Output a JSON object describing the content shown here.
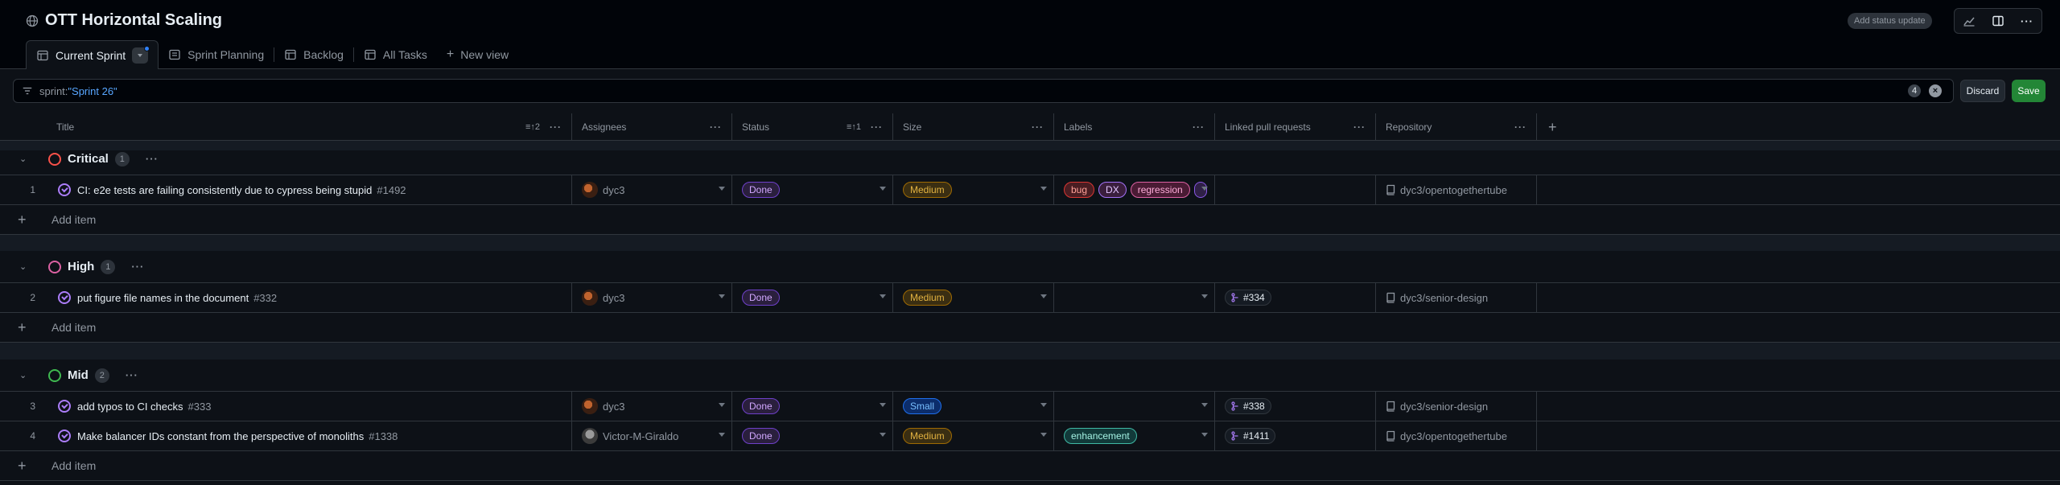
{
  "project": {
    "title": "OTT Horizontal Scaling",
    "status_update": "Add status update"
  },
  "tabs": [
    {
      "label": "Current Sprint"
    },
    {
      "label": "Sprint Planning"
    },
    {
      "label": "Backlog"
    },
    {
      "label": "All Tasks"
    },
    {
      "label": "New view"
    }
  ],
  "filter": {
    "key": "sprint:",
    "value": "\"Sprint 26\"",
    "count": "4",
    "discard": "Discard",
    "save": "Save"
  },
  "columns": {
    "title": "Title",
    "title_sort": "2",
    "assignees": "Assignees",
    "status": "Status",
    "status_sort": "1",
    "size": "Size",
    "labels": "Labels",
    "linked_prs": "Linked pull requests",
    "repository": "Repository"
  },
  "add_item_label": "Add item",
  "groups": [
    {
      "name": "Critical",
      "count": "1",
      "color": "#f85149",
      "rows": [
        {
          "num": "1",
          "title": "CI: e2e tests are failing consistently due to cypress being stupid",
          "issue": "#1492",
          "assignee": "dyc3",
          "status": "Done",
          "size": "Medium",
          "labels": [
            "bug",
            "DX",
            "regression"
          ],
          "pr": "",
          "repo": "dyc3/opentogethertube"
        }
      ]
    },
    {
      "name": "High",
      "count": "1",
      "color": "#db61a2",
      "rows": [
        {
          "num": "2",
          "title": "put figure file names in the document",
          "issue": "#332",
          "assignee": "dyc3",
          "status": "Done",
          "size": "Medium",
          "labels": [],
          "pr": "#334",
          "repo": "dyc3/senior-design"
        }
      ]
    },
    {
      "name": "Mid",
      "count": "2",
      "color": "#3fb950",
      "rows": [
        {
          "num": "3",
          "title": "add typos to CI checks",
          "issue": "#333",
          "assignee": "dyc3",
          "status": "Done",
          "size": "Small",
          "labels": [],
          "pr": "#338",
          "repo": "dyc3/senior-design"
        },
        {
          "num": "4",
          "title": "Make balancer IDs constant from the perspective of monoliths",
          "issue": "#1338",
          "assignee": "Victor-M-Giraldo",
          "status": "Done",
          "size": "Medium",
          "labels": [
            "enhancement"
          ],
          "pr": "#1411",
          "repo": "dyc3/opentogethertube"
        }
      ]
    }
  ]
}
